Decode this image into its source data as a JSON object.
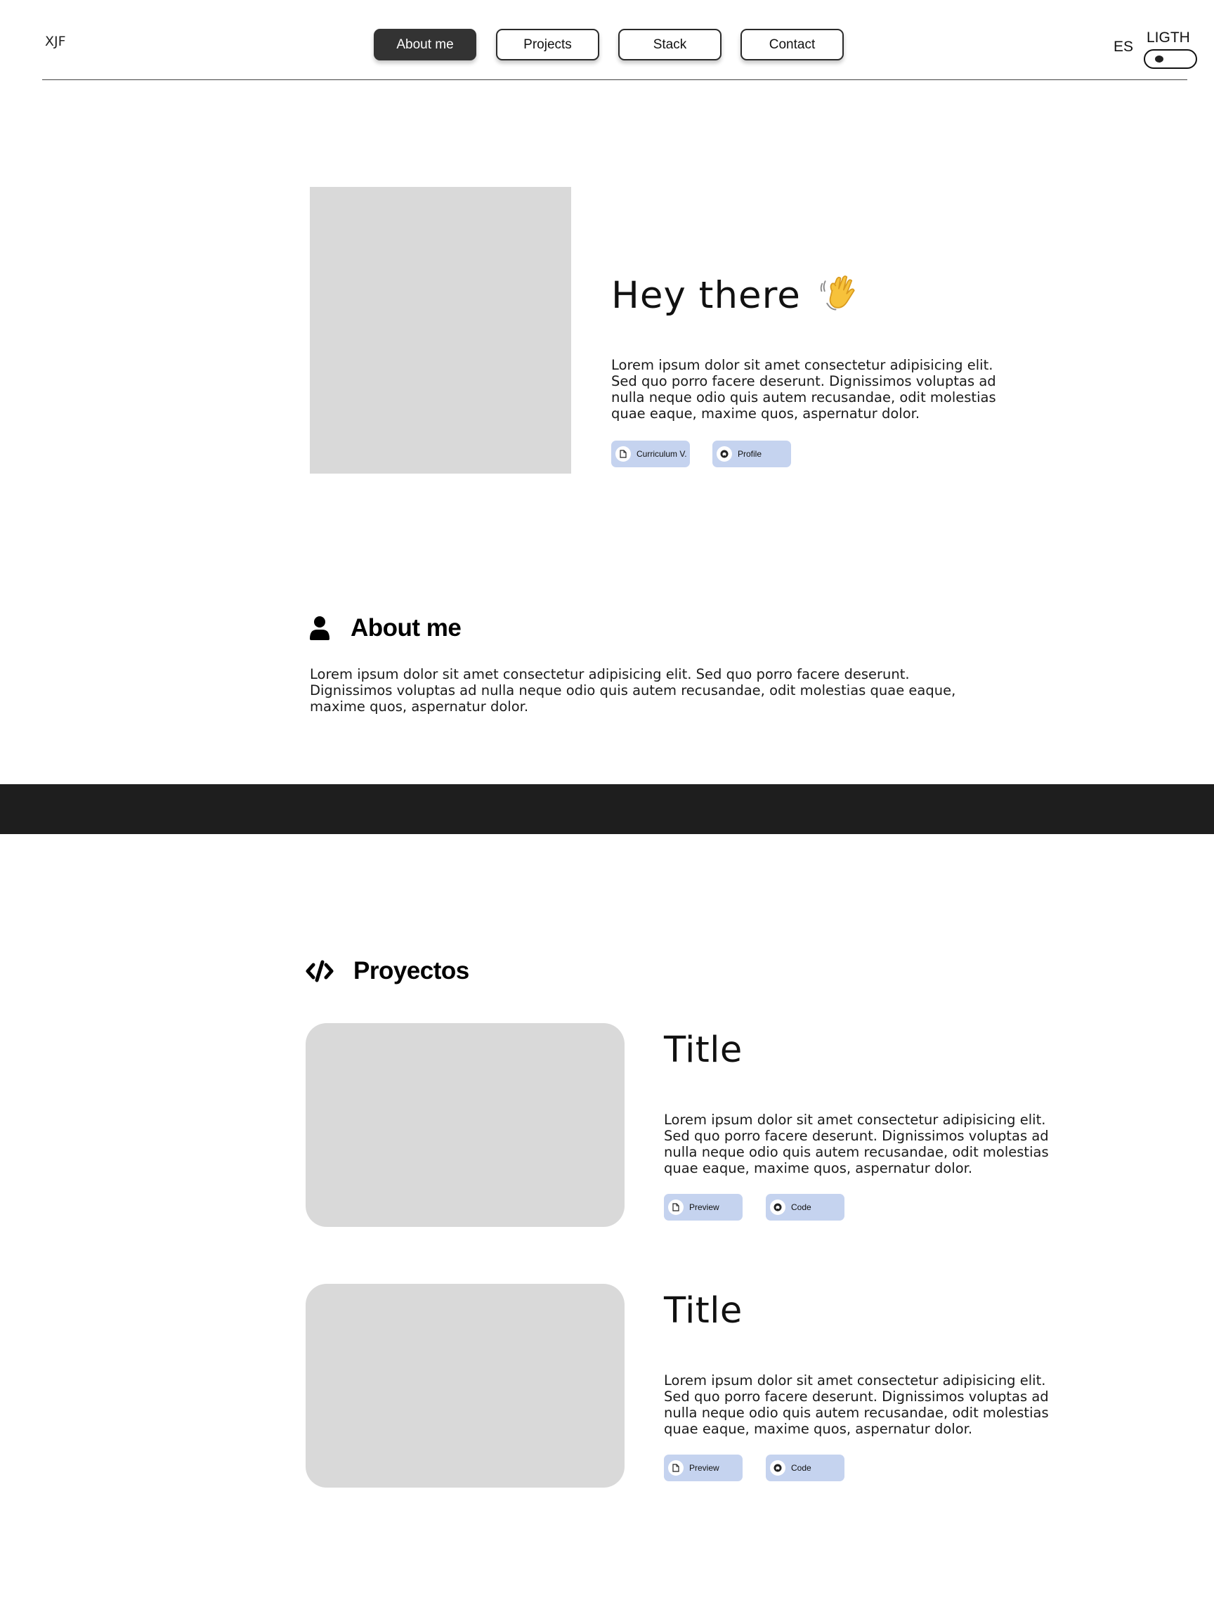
{
  "header": {
    "logo": "XJF",
    "nav": [
      {
        "label": "About me",
        "active": true
      },
      {
        "label": "Projects",
        "active": false
      },
      {
        "label": "Stack",
        "active": false
      },
      {
        "label": "Contact",
        "active": false
      }
    ],
    "language": "ES",
    "theme_label": "LIGTH"
  },
  "hero": {
    "title": "Hey there",
    "emoji": "waving-hand",
    "description": "Lorem ipsum dolor sit amet consectetur adipisicing elit. Sed quo porro facere deserunt. Dignissimos voluptas ad nulla neque odio quis autem recusandae, odit molestias quae eaque, maxime quos, aspernatur dolor.",
    "buttons": [
      {
        "label": "Curriculum V.",
        "icon": "document-icon"
      },
      {
        "label": "Profile",
        "icon": "github-icon"
      }
    ]
  },
  "about": {
    "icon": "user-icon",
    "title": "About me",
    "text": "Lorem ipsum dolor sit amet consectetur adipisicing elit. Sed quo porro facere deserunt. Dignissimos voluptas ad nulla neque odio quis autem recusandae, odit molestias quae eaque, maxime quos, aspernatur dolor."
  },
  "projects": {
    "icon": "code-icon",
    "title": "Proyectos",
    "items": [
      {
        "title": "Title",
        "description": "Lorem ipsum dolor sit amet consectetur adipisicing elit. Sed quo porro facere deserunt. Dignissimos voluptas ad nulla neque odio quis autem recusandae, odit molestias quae eaque, maxime quos, aspernatur dolor.",
        "preview_label": "Preview",
        "code_label": "Code"
      },
      {
        "title": "Title",
        "description": "Lorem ipsum dolor sit amet consectetur adipisicing elit. Sed quo porro facere deserunt. Dignissimos voluptas ad nulla neque odio quis autem recusandae, odit molestias quae eaque, maxime quos, aspernatur dolor.",
        "preview_label": "Preview",
        "code_label": "Code"
      }
    ]
  },
  "colors": {
    "background": "#ffffff",
    "nav_active": "#333333",
    "chip": "#c5d3ef",
    "placeholder": "#d9d9d9",
    "band": "#1e1e1e"
  }
}
